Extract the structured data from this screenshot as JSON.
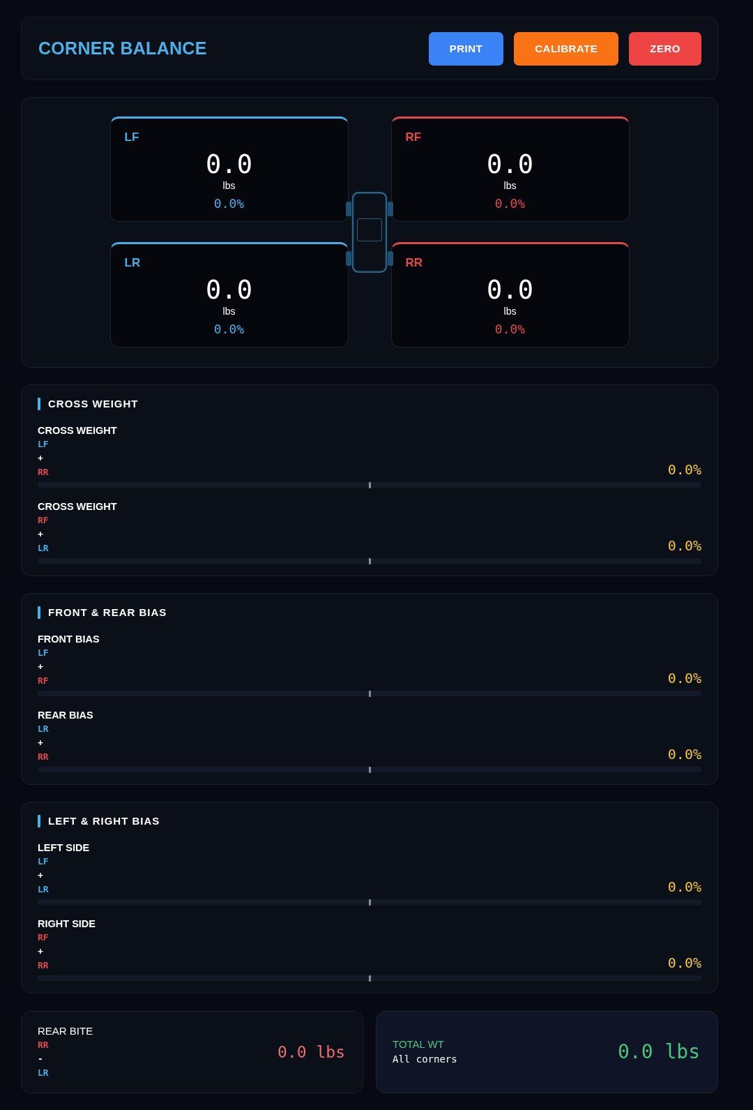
{
  "header": {
    "title": "CORNER BALANCE",
    "buttons": [
      {
        "label": "PRINT",
        "color": "#3b82f6"
      },
      {
        "label": "CALIBRATE",
        "color": "#f97316"
      },
      {
        "label": "ZERO",
        "color": "#ef4444"
      }
    ]
  },
  "corners": [
    {
      "label": "LF",
      "weight": "0.0",
      "unit": "lbs",
      "percent": "0.0%",
      "color": "#4aaee6"
    },
    {
      "label": "RF",
      "weight": "0.0",
      "unit": "lbs",
      "percent": "0.0%",
      "color": "#e04a4a"
    },
    {
      "label": "LR",
      "weight": "0.0",
      "unit": "lbs",
      "percent": "0.0%",
      "color": "#4aaee6"
    },
    {
      "label": "RR",
      "weight": "0.0",
      "unit": "lbs",
      "percent": "0.0%",
      "color": "#e04a4a"
    }
  ],
  "sections": [
    {
      "title": "CROSS WEIGHT",
      "metrics": [
        {
          "label": "CROSS WEIGHT",
          "terms": [
            {
              "text": "LF",
              "color": "#4aaee6"
            },
            {
              "text": "+",
              "color": "#ffffff"
            },
            {
              "text": "RR",
              "color": "#e04a4a"
            }
          ],
          "value": "0.0%"
        },
        {
          "label": "CROSS WEIGHT",
          "terms": [
            {
              "text": "RF",
              "color": "#e04a4a"
            },
            {
              "text": "+",
              "color": "#ffffff"
            },
            {
              "text": "LR",
              "color": "#4aaee6"
            }
          ],
          "value": "0.0%"
        }
      ]
    },
    {
      "title": "FRONT & REAR BIAS",
      "metrics": [
        {
          "label": "FRONT BIAS",
          "terms": [
            {
              "text": "LF",
              "color": "#4aaee6"
            },
            {
              "text": "+",
              "color": "#ffffff"
            },
            {
              "text": "RF",
              "color": "#e04a4a"
            }
          ],
          "value": "0.0%"
        },
        {
          "label": "REAR BIAS",
          "terms": [
            {
              "text": "LR",
              "color": "#4aaee6"
            },
            {
              "text": "+",
              "color": "#ffffff"
            },
            {
              "text": "RR",
              "color": "#e04a4a"
            }
          ],
          "value": "0.0%"
        }
      ]
    },
    {
      "title": "LEFT & RIGHT BIAS",
      "metrics": [
        {
          "label": "LEFT SIDE",
          "terms": [
            {
              "text": "LF",
              "color": "#4aaee6"
            },
            {
              "text": "+",
              "color": "#ffffff"
            },
            {
              "text": "LR",
              "color": "#4aaee6"
            }
          ],
          "value": "0.0%"
        },
        {
          "label": "RIGHT SIDE",
          "terms": [
            {
              "text": "RF",
              "color": "#e04a4a"
            },
            {
              "text": "+",
              "color": "#ffffff"
            },
            {
              "text": "RR",
              "color": "#e04a4a"
            }
          ],
          "value": "0.0%"
        }
      ]
    }
  ],
  "summary": [
    {
      "kind": "difference",
      "title": "REAR BITE",
      "terms": [
        {
          "text": "RR",
          "color": "#e04a4a"
        },
        {
          "text": "-",
          "color": "#ffffff"
        },
        {
          "text": "LR",
          "color": "#4aaee6"
        }
      ],
      "value": "0.0 lbs",
      "color": "#ec6f6f"
    },
    {
      "kind": "total",
      "title": "TOTAL WT",
      "subtitle": "All corners",
      "value": "0.0 lbs",
      "color": "#4cc47c"
    }
  ]
}
